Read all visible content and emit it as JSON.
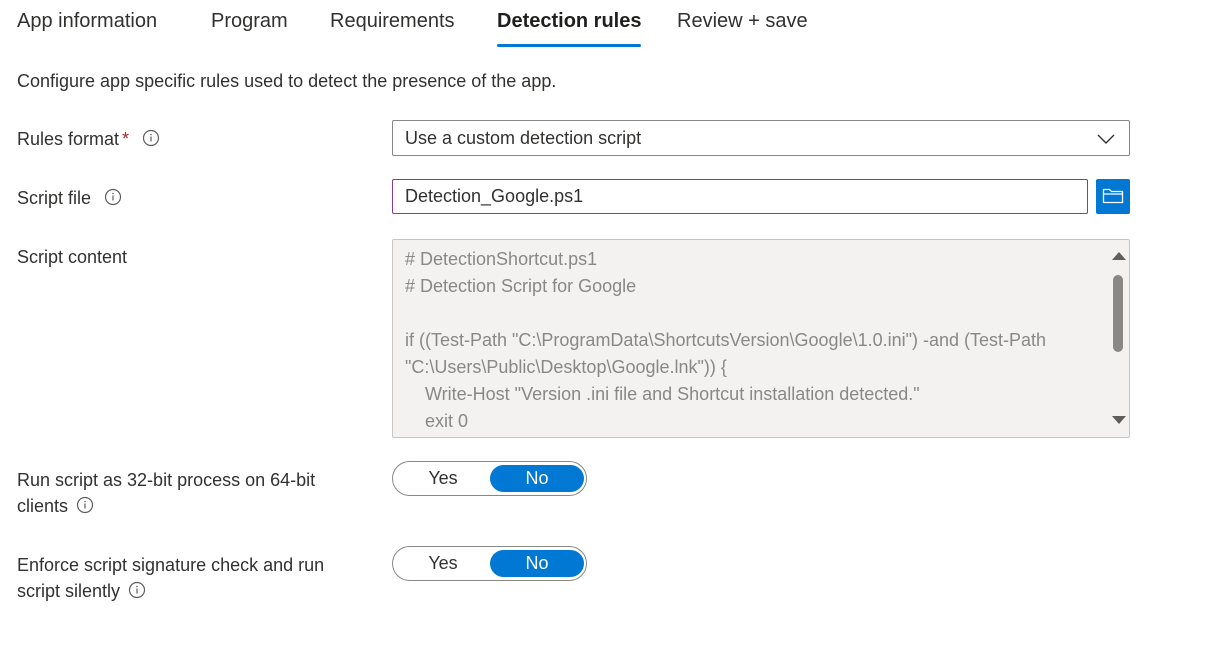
{
  "tabs": [
    {
      "label": "App information",
      "active": false
    },
    {
      "label": "Program",
      "active": false
    },
    {
      "label": "Requirements",
      "active": false
    },
    {
      "label": "Detection rules",
      "active": true
    },
    {
      "label": "Review + save",
      "active": false
    }
  ],
  "description": "Configure app specific rules used to detect the presence of the app.",
  "rules_format": {
    "label": "Rules format",
    "required_marker": "*",
    "value": "Use a custom detection script"
  },
  "script_file": {
    "label": "Script file",
    "value": "Detection_Google.ps1"
  },
  "script_content": {
    "label": "Script content",
    "text": "# DetectionShortcut.ps1\n# Detection Script for Google\n\nif ((Test-Path \"C:\\ProgramData\\ShortcutsVersion\\Google\\1.0.ini\") -and (Test-Path\n\"C:\\Users\\Public\\Desktop\\Google.lnk\")) {\n    Write-Host \"Version .ini file and Shortcut installation detected.\"\n    exit 0"
  },
  "run_32bit": {
    "label_line1": "Run script as 32-bit process on 64-bit",
    "label_line2": "clients",
    "yes_label": "Yes",
    "no_label": "No",
    "selected": "No"
  },
  "signature_check": {
    "label_line1": "Enforce script signature check and run",
    "label_line2": "script silently",
    "yes_label": "Yes",
    "no_label": "No",
    "selected": "No"
  },
  "colors": {
    "accent": "#0078d4",
    "required": "#a4262c",
    "focus_border": "#8b3a8f"
  }
}
